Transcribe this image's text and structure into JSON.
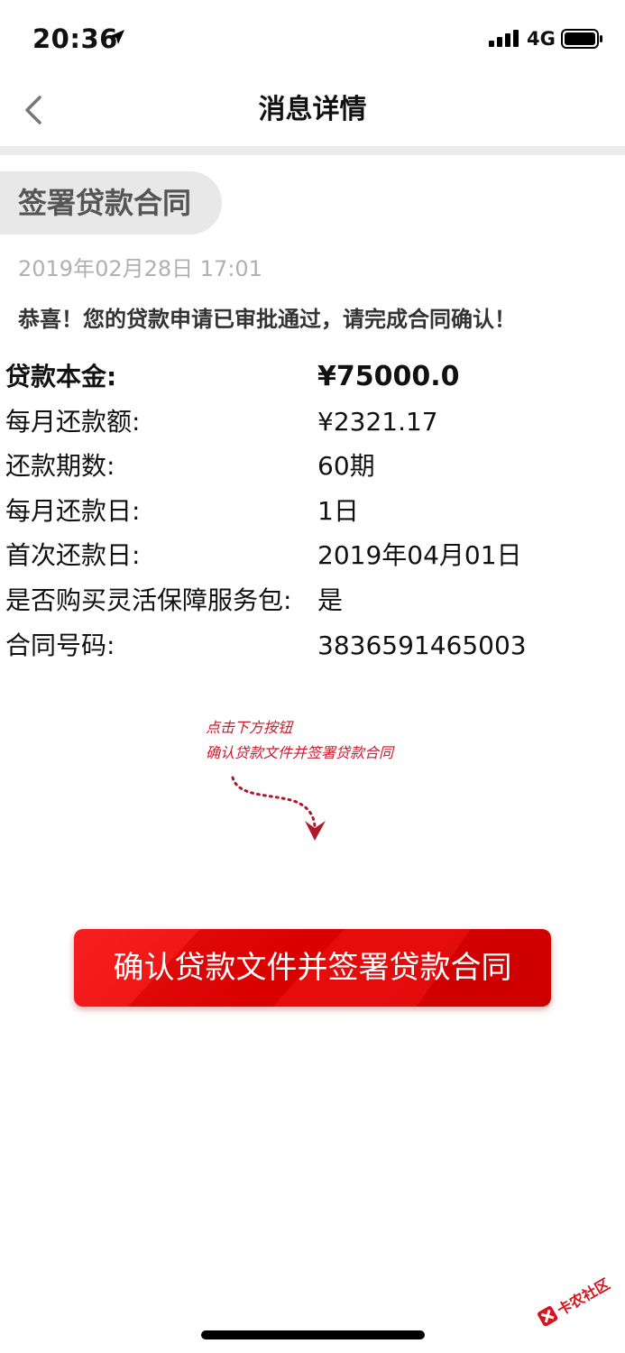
{
  "status_bar": {
    "time": "20:36",
    "network": "4G"
  },
  "nav": {
    "title": "消息详情",
    "back_icon": "chevron-left-icon"
  },
  "message": {
    "tag": "签署贷款合同",
    "timestamp": "2019年02月28日 17:01",
    "congrats": "恭喜！您的贷款申请已审批通过，请完成合同确认！",
    "details": [
      {
        "label": "贷款本金:",
        "value": "¥75000.0"
      },
      {
        "label": "每月还款额:",
        "value": "¥2321.17"
      },
      {
        "label": "还款期数:",
        "value": "60期"
      },
      {
        "label": "每月还款日:",
        "value": "1日"
      },
      {
        "label": "首次还款日:",
        "value": "2019年04月01日"
      },
      {
        "label": "是否购买灵活保障服务包:",
        "value": "是"
      },
      {
        "label": "合同号码:",
        "value": "3836591465003"
      }
    ]
  },
  "hint": {
    "line1": "点击下方按钮",
    "line2": "确认贷款文件并签署贷款合同"
  },
  "confirm_button": {
    "label": "确认贷款文件并签署贷款合同"
  },
  "watermark": {
    "text": "卡农社区"
  },
  "colors": {
    "accent_red": "#e10000",
    "hint_red": "#cc1a2c",
    "tag_bg": "#e8e8e8",
    "divider": "#ececec"
  }
}
